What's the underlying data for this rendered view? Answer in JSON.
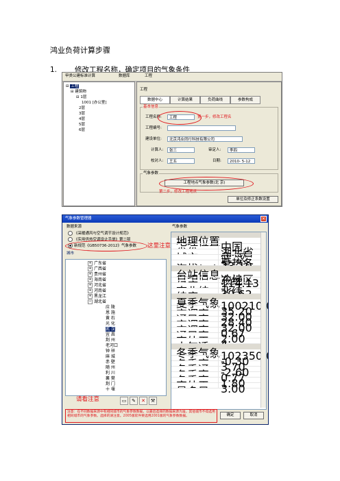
{
  "doc": {
    "title": "鸿业负荷计算步骤",
    "step1_num": "1.",
    "step1_text": "修改工程名称，确定项目的气象条件"
  },
  "shot1": {
    "toolbar": [
      "甲类公建标准计算",
      "数据库",
      "工程"
    ],
    "tree": {
      "root": "工程",
      "building": "建筑物",
      "floor1": "1层",
      "room": "1001 [办公室]",
      "floors": [
        "2层",
        "3层",
        "4层",
        "5层",
        "6层"
      ]
    },
    "panel_title": "工程",
    "tabs": [
      "数据中心",
      "计算结果",
      "负荷曲线",
      "参数构成"
    ],
    "info_group": "基本信息",
    "labels": {
      "project_name": "工程名称:",
      "project_no": "工程编号:",
      "builder": "建设单位:",
      "calculator": "计算人:",
      "reviewer": "审定人:",
      "proofreader": "校对人:",
      "date": "日期:"
    },
    "values": {
      "project_name": "工程",
      "builder": "北京鸿业同行科技有限公司",
      "calculator": "张三",
      "reviewer": "李四",
      "proofreader": "王五",
      "date": "2010- 5-12"
    },
    "weather_group": "气象参数",
    "weather_button": "工程地点气象参数(北 京)",
    "unit_button": "单位及修正系数设置",
    "note1": "第一步，修改工程名",
    "note2": "第二步，修改工程地点"
  },
  "shot2": {
    "window_title": "气象参数管理器",
    "db_group": "数据来源",
    "sources": [
      "《采暖通风与空气调节设计规范》",
      "《实用供热空调设计手册》第二版",
      "新规范《GB50736-2012》气象参数"
    ],
    "city_label": "城市",
    "provinces": [
      "广东省",
      "广西省",
      "贵州省",
      "海南省",
      "河北省",
      "河南省",
      "黑龙江",
      "湖北省"
    ],
    "cities": [
      "应 陵",
      "恩 施",
      "黄 石",
      "光 化",
      "武 汉",
      "宜 昌",
      "荆 州",
      "老河口",
      "钟 祥",
      "麻 城",
      "赤 壁",
      "随 州",
      "利 川",
      "襄 樊",
      "荆 门",
      "十 堰",
      "孝 感",
      "咸 宁"
    ],
    "weather_label": "气象参数",
    "sections": {
      "basic": "地理位置",
      "location": "台站信息",
      "summer": "夏季气象",
      "winter": "冬季气象"
    },
    "rows_basic": [
      [
        "国家",
        "中国"
      ],
      [
        "省份",
        "湖北省"
      ],
      [
        "城市",
        "武 汉"
      ],
      [
        "",
        "夏热冬冷地区"
      ],
      [
        "海拔(m)",
        "23.10"
      ]
    ],
    "rows_location": [
      [
        "东西经",
        "东经"
      ],
      [
        "经度",
        "114.13"
      ],
      [
        "南北纬",
        "北纬"
      ],
      [
        "纬度",
        "30.62"
      ]
    ],
    "rows_summer": [
      [
        "夏季大气压(Pa)",
        "100210.00"
      ],
      [
        "空调室外干球温度(℃)",
        "35.20"
      ],
      [
        "通风室外干球温度(℃)",
        "32.00"
      ],
      [
        "空调室外湿球温度(℃)",
        "28.40"
      ],
      [
        "空调室外日平均温度(℃)",
        "32.00"
      ],
      [
        "通风室外相对湿度(%)",
        "0.67"
      ],
      [
        "室外平均风速(m/s)",
        "2.00"
      ],
      [
        "大气透明度等级",
        "4"
      ]
    ],
    "rows_winter": [
      [
        "冬季大气压(Pa)",
        "102350.00"
      ],
      [
        "冬季室外供暖计算干球",
        "-0.30"
      ],
      [
        "冬季通风计算干球温度",
        "3.70"
      ],
      [
        "冬季室外空调计算干球",
        "-2.60"
      ],
      [
        "冬季室外空调计算相对",
        "0.77"
      ],
      [
        "室外平均风速(m/s)",
        "1.80"
      ],
      [
        "最多风向平均风速(m/s)",
        "3.00"
      ]
    ],
    "note_select": "这里注意选择新规范",
    "note_attention": "请看注意",
    "warning": "注意：在不同数据来源中有相同城市的气象参数数据，以最后选择的数据来源为准，其他城市不得选用相同城市的气象参数。选择的请注意。2005版软件要选用2001版的气象参数数据。",
    "ok": "确定",
    "cancel": "取消",
    "icons": [
      "folder-icon",
      "edit-icon",
      "delete-icon",
      "tools-icon"
    ]
  }
}
